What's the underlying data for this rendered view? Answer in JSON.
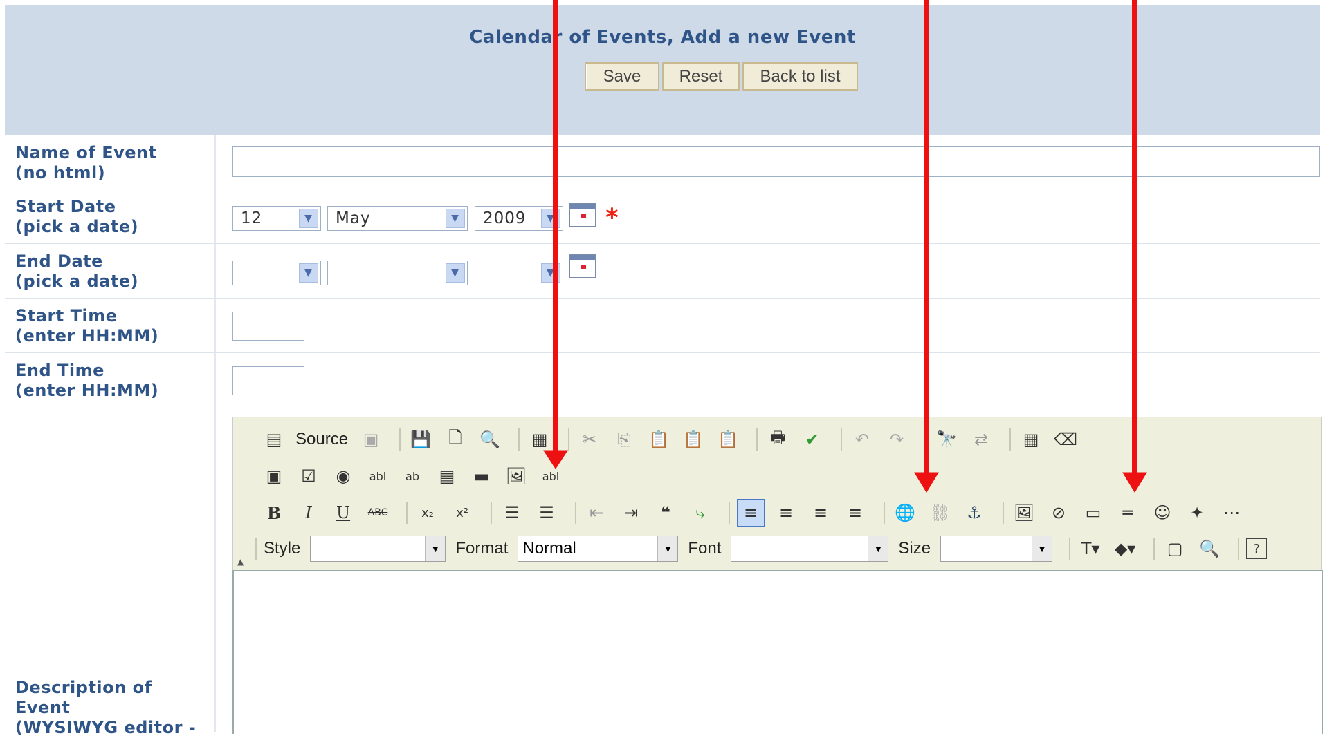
{
  "header": {
    "title": "Calendar of Events, Add a new Event",
    "buttons": {
      "save": "Save",
      "reset": "Reset",
      "back": "Back to list"
    }
  },
  "fields": {
    "name_label": "Name of Event\n(no html)",
    "start_date_label": "Start Date\n(pick a date)",
    "end_date_label": "End Date\n(pick a date)",
    "start_time_label": "Start Time\n(enter HH:MM)",
    "end_time_label": "End Time\n(enter HH:MM)",
    "description_label": "Description of\nEvent\n(WYSIWYG editor -"
  },
  "start_date": {
    "day": "12",
    "month": "May",
    "year": "2009"
  },
  "end_date": {
    "day": "",
    "month": "",
    "year": ""
  },
  "required_marker": "*",
  "editor": {
    "source_label": "Source",
    "style_label": "Style",
    "format_label": "Format",
    "format_value": "Normal",
    "font_label": "Font",
    "size_label": "Size",
    "style_value": "",
    "font_value": "",
    "size_value": ""
  },
  "annotation": {
    "arrow_color": "#ee1111",
    "arrow_count": 3
  }
}
